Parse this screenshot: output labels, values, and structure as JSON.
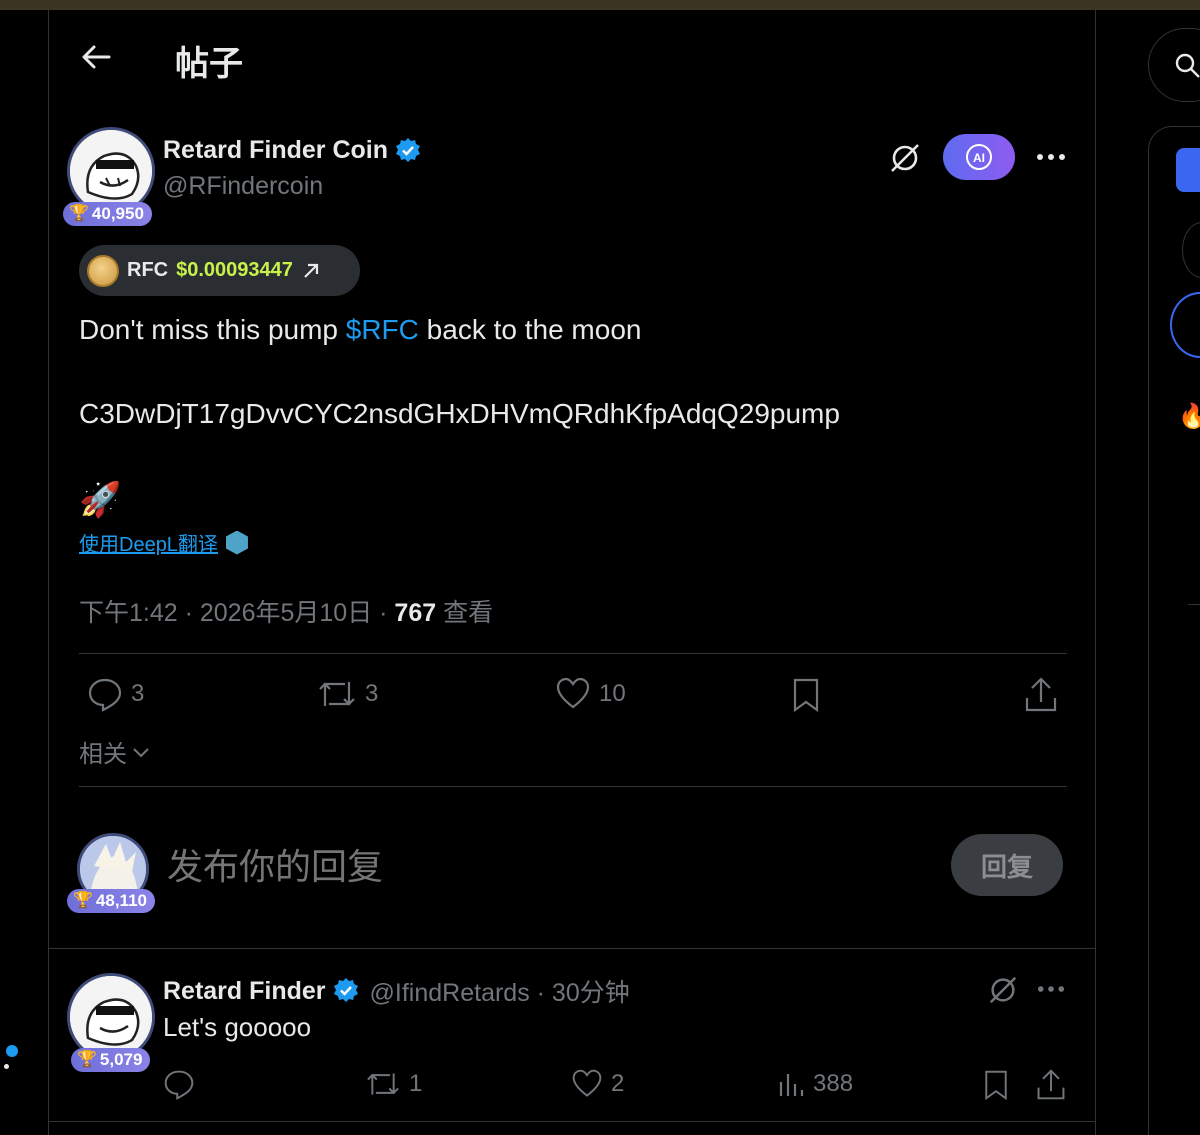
{
  "header": {
    "title": "帖子"
  },
  "post": {
    "author_name": "Retard Finder Coin",
    "author_handle": "@RFindercoin",
    "badge_score": "40,950",
    "token": {
      "symbol": "RFC",
      "price": "$0.00093447"
    },
    "text_before": "Don't miss this pump ",
    "cashtag": "$RFC",
    "text_after": " back to the moon",
    "contract": "C3DwDjT17gDvvCYC2nsdGHxDHVmQRdhKfpAdqQ29pump",
    "emoji": "🚀",
    "translate": "使用DeepL翻译",
    "time": "下午1:42 · 2026年5月10日 · ",
    "views": "767",
    "views_label": " 查看",
    "replies": "3",
    "reposts": "3",
    "likes": "10",
    "ai_label": "AI"
  },
  "related": {
    "label": "相关"
  },
  "reply_box": {
    "placeholder": "发布你的回复",
    "button": "回复",
    "badge_score": "48,110"
  },
  "reply_tweet": {
    "author_name": "Retard Finder",
    "handle_time": "@IfindRetards · 30分钟",
    "text": "Let's gooooo",
    "badge_score": "5,079",
    "reposts": "1",
    "likes": "2",
    "views": "388"
  },
  "colors": {
    "accent": "#1d9bf0",
    "price": "#c6f24a",
    "badge": "#7a78e0"
  }
}
